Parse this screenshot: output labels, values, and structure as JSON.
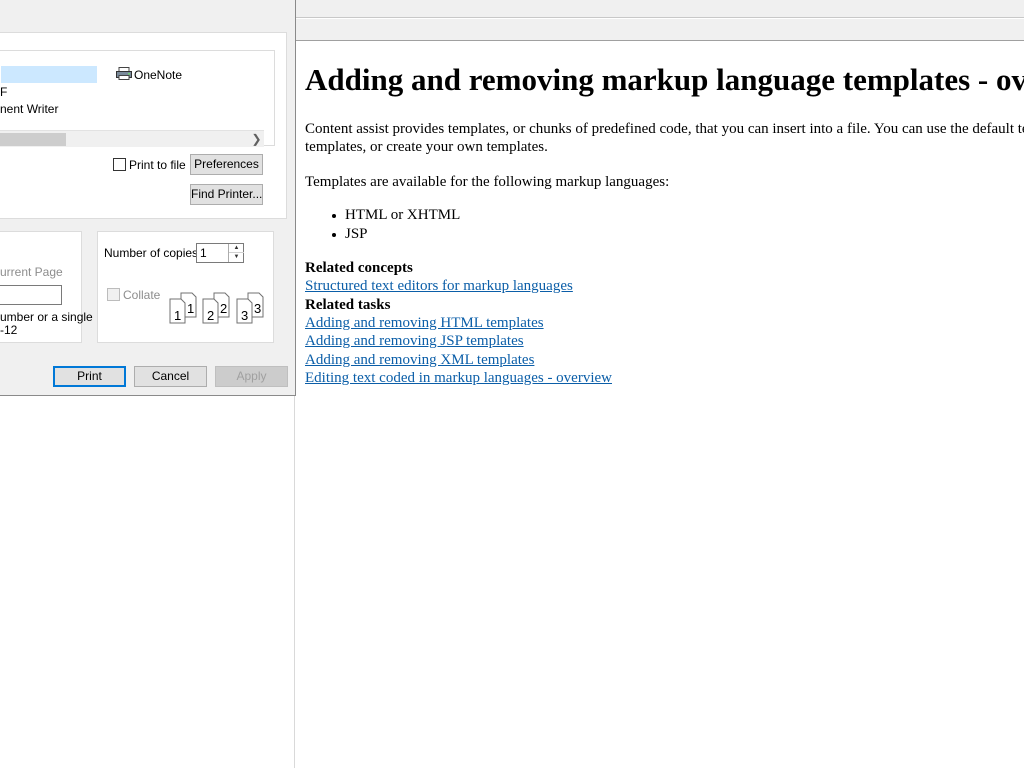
{
  "help_page": {
    "title": "Adding and removing markup language templates - overview",
    "intro_line1": "Content assist provides templates, or chunks of predefined code, that you can insert into a file. You can use the default templates,",
    "intro_line2": "templates, or create your own templates.",
    "languages_intro": "Templates are available for the following markup languages:",
    "languages": [
      "HTML or XHTML",
      "JSP"
    ],
    "related_concepts_heading": "Related concepts",
    "related_concepts": [
      "Structured text editors for markup languages"
    ],
    "related_tasks_heading": "Related tasks",
    "related_tasks": [
      "Adding and removing HTML templates",
      "Adding and removing JSP templates",
      "Adding and removing XML templates",
      "Editing text coded in markup languages - overview"
    ]
  },
  "print_dialog": {
    "printers": {
      "onenote": "OneNote",
      "pdf": "F",
      "writer": "nent Writer"
    },
    "print_to_file_label": "Print to file",
    "preferences_label": "Preferences",
    "find_printer_label": "Find Printer...",
    "range": {
      "current_page_label": "urrent Page",
      "hint_line1": "umber or a single",
      "hint_line2": "-12"
    },
    "copies": {
      "label": "Number of copies:",
      "value": "1",
      "collate_label": "Collate",
      "collate_pages": [
        "1",
        "1",
        "2",
        "2",
        "3",
        "3"
      ]
    },
    "buttons": {
      "print": "Print",
      "cancel": "Cancel",
      "apply": "Apply"
    }
  },
  "colors": {
    "link": "#0b5ea8",
    "selection": "#cce8ff",
    "default_button_border": "#0078d7",
    "dialog_bg": "#f0f0f0"
  }
}
